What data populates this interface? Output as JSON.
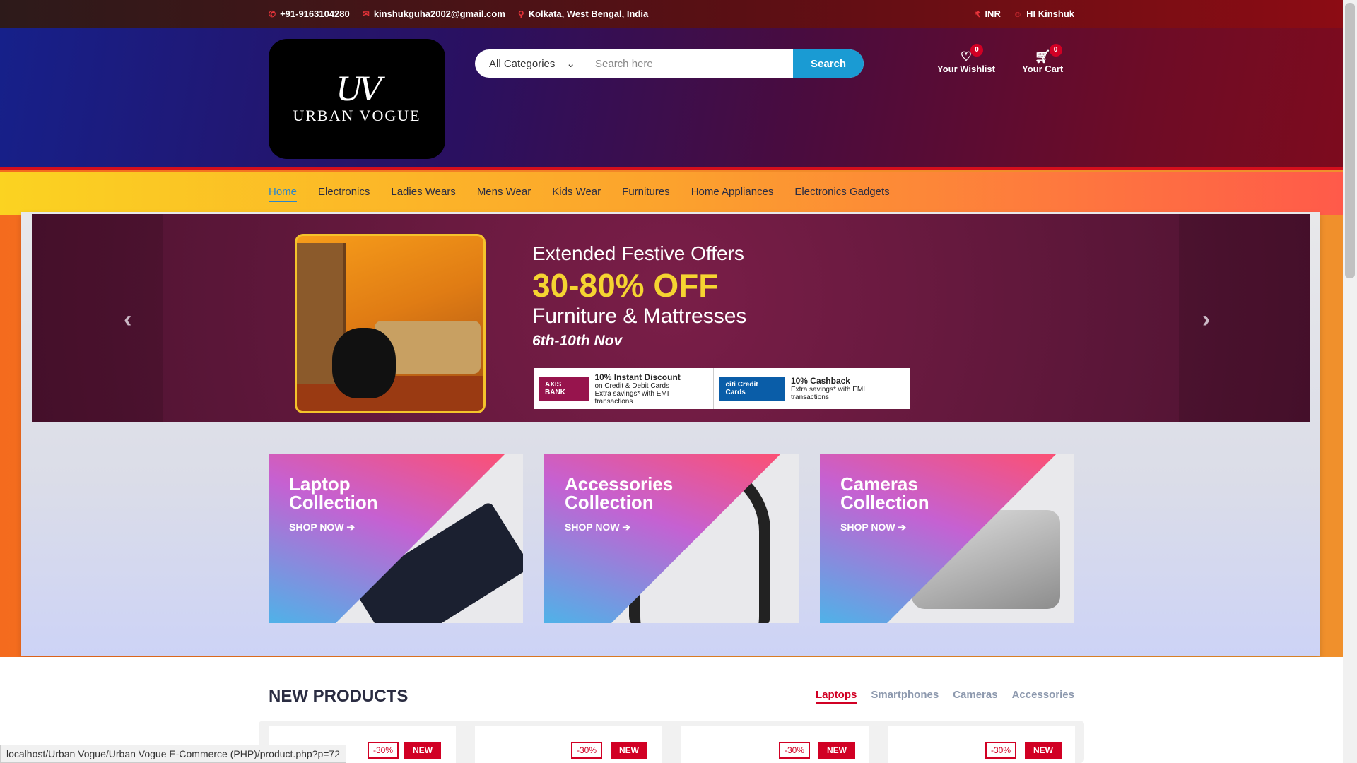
{
  "topbar": {
    "phone": "+91-9163104280",
    "email": "kinshukguha2002@gmail.com",
    "location": "Kolkata, West Bengal, India",
    "currency": "INR",
    "greeting": "HI Kinshuk"
  },
  "header": {
    "logo_mono": "UV",
    "logo_name": "URBAN VOGUE",
    "category_selected": "All Categories",
    "search_placeholder": "Search here",
    "search_button": "Search",
    "wishlist_label": "Your Wishlist",
    "wishlist_count": "0",
    "cart_label": "Your Cart",
    "cart_count": "0"
  },
  "nav": {
    "items": [
      "Home",
      "Electronics",
      "Ladies Wears",
      "Mens Wear",
      "Kids Wear",
      "Furnitures",
      "Home Appliances",
      "Electronics Gadgets"
    ],
    "active": "Home"
  },
  "slider": {
    "line1": "Extended Festive Offers",
    "line2": "30-80% OFF",
    "line3": "Furniture & Mattresses",
    "line4": "6th-10th Nov",
    "offer1_bank": "AXIS BANK",
    "offer1_title": "10% Instant Discount",
    "offer1_sub": "on Credit & Debit Cards",
    "offer1_sub2": "Extra savings* with EMI transactions",
    "offer2_bank": "citi Credit Cards",
    "offer2_title": "10% Cashback",
    "offer2_sub": "Extra savings* with EMI transactions"
  },
  "collections": [
    {
      "title1": "Laptop",
      "title2": "Collection",
      "cta": "SHOP NOW"
    },
    {
      "title1": "Accessories",
      "title2": "Collection",
      "cta": "SHOP NOW"
    },
    {
      "title1": "Cameras",
      "title2": "Collection",
      "cta": "SHOP NOW"
    }
  ],
  "new_products": {
    "title": "NEW PRODUCTS",
    "tabs": [
      "Laptops",
      "Smartphones",
      "Cameras",
      "Accessories"
    ],
    "sale_tag": "-30%",
    "new_tag": "NEW"
  },
  "status_url": "localhost/Urban Vogue/Urban Vogue E-Commerce (PHP)/product.php?p=72"
}
